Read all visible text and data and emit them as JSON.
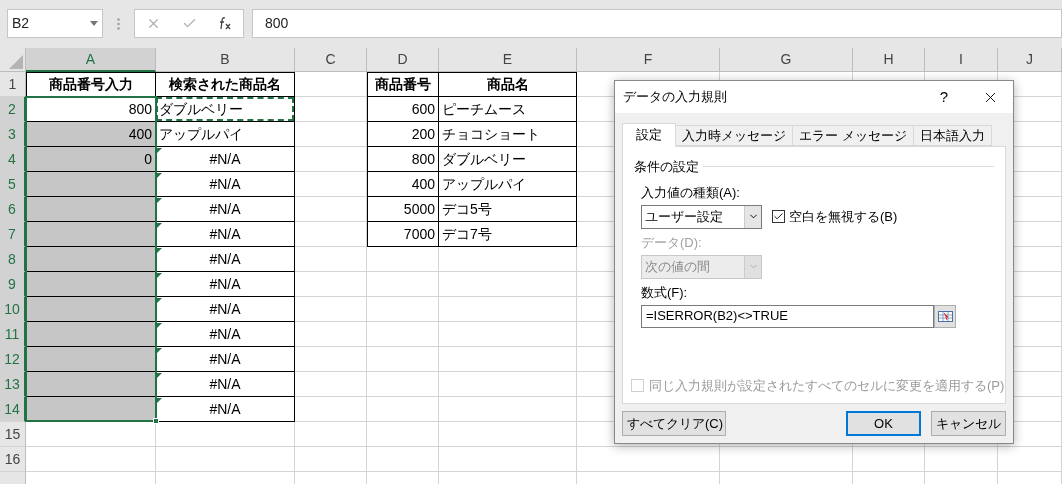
{
  "name_box": "B2",
  "formula_bar": {
    "value": "800"
  },
  "columns": [
    {
      "label": "A",
      "selected": true
    },
    {
      "label": "B",
      "selected": false
    },
    {
      "label": "C",
      "selected": false
    },
    {
      "label": "D",
      "selected": false
    },
    {
      "label": "E",
      "selected": false
    },
    {
      "label": "F",
      "selected": false
    },
    {
      "label": "G",
      "selected": false
    },
    {
      "label": "H",
      "selected": false
    },
    {
      "label": "I",
      "selected": false
    },
    {
      "label": "J",
      "selected": false
    }
  ],
  "rows": [
    {
      "label": "1",
      "selected": false,
      "a": {
        "text": "商品番号入力",
        "kind": "header"
      },
      "b": {
        "text": "検索された商品名",
        "kind": "header"
      },
      "d": {
        "text": "商品番号",
        "kind": "header"
      },
      "e": {
        "text": "商品名",
        "kind": "header"
      }
    },
    {
      "label": "2",
      "selected": true,
      "a": {
        "text": "800",
        "kind": "number",
        "active": true
      },
      "b": {
        "text": "ダブルベリー",
        "kind": "text",
        "marquee": true
      },
      "d": {
        "text": "600",
        "kind": "number"
      },
      "e": {
        "text": "ピーチムース",
        "kind": "text"
      }
    },
    {
      "label": "3",
      "selected": true,
      "a": {
        "text": "400",
        "kind": "number",
        "selected": true
      },
      "b": {
        "text": "アップルパイ",
        "kind": "text"
      },
      "d": {
        "text": "200",
        "kind": "number"
      },
      "e": {
        "text": "チョコショート",
        "kind": "text"
      }
    },
    {
      "label": "4",
      "selected": true,
      "a": {
        "text": "0",
        "kind": "number",
        "selected": true
      },
      "b": {
        "text": "#N/A",
        "kind": "error",
        "error_flag": true
      },
      "d": {
        "text": "800",
        "kind": "number"
      },
      "e": {
        "text": "ダブルベリー",
        "kind": "text"
      }
    },
    {
      "label": "5",
      "selected": true,
      "a": {
        "kind": "number",
        "selected": true
      },
      "b": {
        "text": "#N/A",
        "kind": "error",
        "error_flag": true
      },
      "d": {
        "text": "400",
        "kind": "number"
      },
      "e": {
        "text": "アップルパイ",
        "kind": "text"
      }
    },
    {
      "label": "6",
      "selected": true,
      "a": {
        "kind": "number",
        "selected": true
      },
      "b": {
        "text": "#N/A",
        "kind": "error",
        "error_flag": true
      },
      "d": {
        "text": "5000",
        "kind": "number"
      },
      "e": {
        "text": "デコ5号",
        "kind": "text"
      }
    },
    {
      "label": "7",
      "selected": true,
      "a": {
        "kind": "number",
        "selected": true
      },
      "b": {
        "text": "#N/A",
        "kind": "error",
        "error_flag": true
      },
      "d": {
        "text": "7000",
        "kind": "number"
      },
      "e": {
        "text": "デコ7号",
        "kind": "text"
      }
    },
    {
      "label": "8",
      "selected": true,
      "a": {
        "kind": "number",
        "selected": true
      },
      "b": {
        "text": "#N/A",
        "kind": "error",
        "error_flag": true
      }
    },
    {
      "label": "9",
      "selected": true,
      "a": {
        "kind": "number",
        "selected": true
      },
      "b": {
        "text": "#N/A",
        "kind": "error",
        "error_flag": true
      }
    },
    {
      "label": "10",
      "selected": true,
      "a": {
        "kind": "number",
        "selected": true
      },
      "b": {
        "text": "#N/A",
        "kind": "error",
        "error_flag": true
      }
    },
    {
      "label": "11",
      "selected": true,
      "a": {
        "kind": "number",
        "selected": true
      },
      "b": {
        "text": "#N/A",
        "kind": "error",
        "error_flag": true
      }
    },
    {
      "label": "12",
      "selected": true,
      "a": {
        "kind": "number",
        "selected": true
      },
      "b": {
        "text": "#N/A",
        "kind": "error",
        "error_flag": true
      }
    },
    {
      "label": "13",
      "selected": true,
      "a": {
        "kind": "number",
        "selected": true
      },
      "b": {
        "text": "#N/A",
        "kind": "error",
        "error_flag": true
      }
    },
    {
      "label": "14",
      "selected": true,
      "a": {
        "kind": "number",
        "selected": true
      },
      "b": {
        "text": "#N/A",
        "kind": "error",
        "error_flag": true
      }
    },
    {
      "label": "15",
      "selected": false
    },
    {
      "label": "16",
      "selected": false
    }
  ],
  "dialog": {
    "title": "データの入力規則",
    "help": "?",
    "tabs": [
      {
        "label": "設定",
        "selected": true
      },
      {
        "label": "入力時メッセージ",
        "selected": false
      },
      {
        "label": "エラー メッセージ",
        "selected": false
      },
      {
        "label": "日本語入力",
        "selected": false
      }
    ],
    "section": "条件の設定",
    "allow": {
      "label": "入力値の種類(A):",
      "value": "ユーザー設定"
    },
    "ignore_blank": {
      "label": "空白を無視する(B)",
      "checked": true
    },
    "data_select": {
      "label": "データ(D):",
      "value": "次の値の間",
      "disabled": true
    },
    "formula": {
      "label": "数式(F):",
      "value": "=ISERROR(B2)<>TRUE"
    },
    "apply_all": {
      "label": "同じ入力規則が設定されたすべてのセルに変更を適用する(P)",
      "checked": false,
      "disabled": true
    },
    "buttons": [
      {
        "label": "すべてクリア(C)",
        "kind": "clear",
        "default": false
      },
      {
        "label": "OK",
        "kind": "ok",
        "default": true
      },
      {
        "label": "キャンセル",
        "kind": "cancel",
        "default": false
      }
    ]
  }
}
